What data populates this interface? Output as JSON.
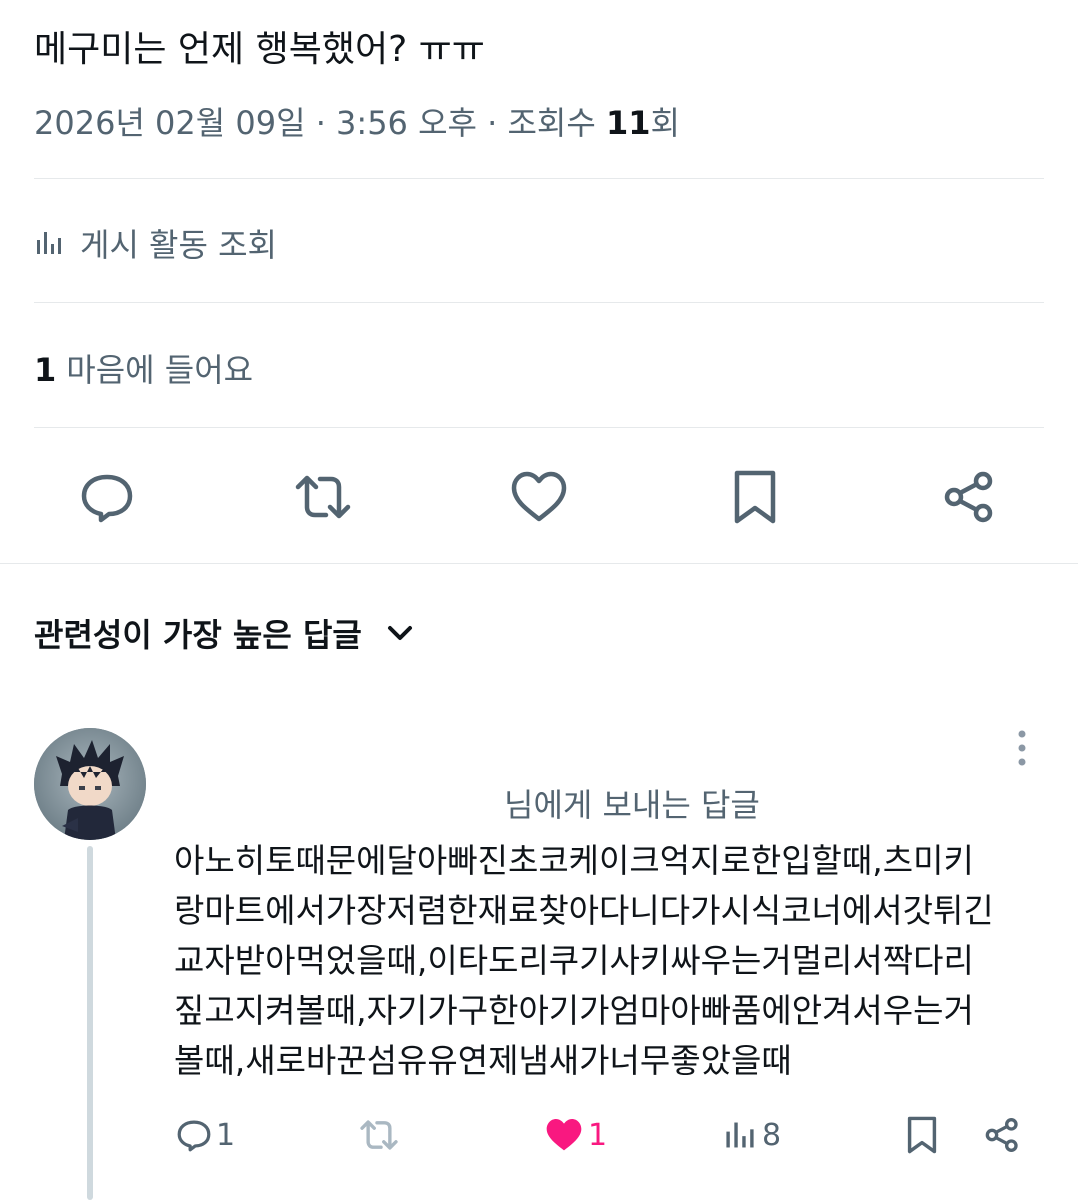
{
  "post": {
    "text": "메구미는 언제 행복했어? ㅠㅠ",
    "timestamp": "2026년 02월 09일 · 3:56 오후 · 조회수 ",
    "view_count": "11",
    "view_unit": "회"
  },
  "activity": {
    "label": "게시 활동 조회",
    "icon": "analytics-icon"
  },
  "likes": {
    "count": "1",
    "label": "마음에 들어요"
  },
  "actions": [
    {
      "name": "reply",
      "icon": "reply-icon"
    },
    {
      "name": "repost",
      "icon": "repost-icon"
    },
    {
      "name": "like",
      "icon": "heart-icon"
    },
    {
      "name": "bookmark",
      "icon": "bookmark-icon"
    },
    {
      "name": "share",
      "icon": "share-icon"
    }
  ],
  "replies_header": {
    "sort_label": "관련성이 가장 높은 답글",
    "icon": "chevron-down-icon"
  },
  "reply": {
    "reply_to": "님에게 보내는 답글",
    "lines": [
      "아노히토때문에달아빠진초코케이크억지로한입할때,츠미키",
      "랑마트에서가장저렴한재료찾아다니다가시식코너에서갓튀긴",
      "교자받아먹었을때,이타도리쿠기사키싸우는거멀리서짝다리",
      "짚고지켜볼때,자기가구한아기가엄마아빠품에안겨서우는거",
      "볼때,새로바꾼섬유유연제냄새가너무좋았을때"
    ],
    "stats": {
      "replies": "1",
      "reposts": "",
      "likes": "1",
      "views": "8"
    }
  },
  "colors": {
    "text": "#0f1419",
    "secondary": "#536471",
    "divider": "#e6e9eb",
    "like_pink": "#f91880",
    "thread_line": "#cfd9de"
  }
}
